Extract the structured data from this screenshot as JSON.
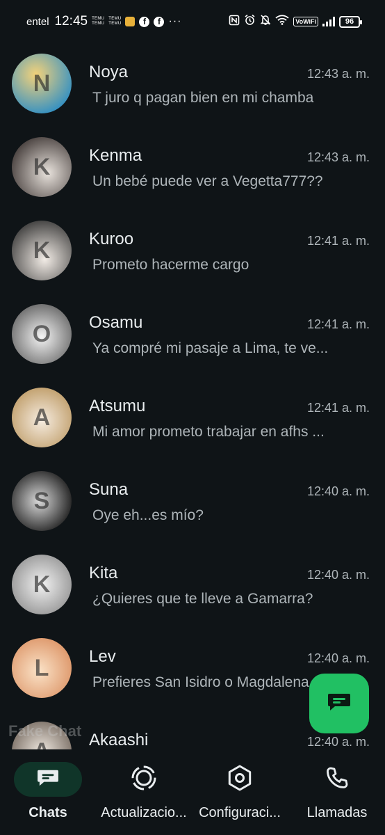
{
  "status_bar": {
    "carrier": "entel",
    "time": "12:45",
    "temu_line1": "TEMU",
    "temu_line2": "TEMU",
    "more": "···",
    "vowifi": "VoWiFi",
    "battery": "96",
    "icons": [
      "temu-icon",
      "temu-icon",
      "notification-icon",
      "facebook-icon",
      "facebook-icon",
      "more-icon",
      "nfc-icon",
      "alarm-icon",
      "silent-icon",
      "wifi-icon",
      "vowifi-icon",
      "signal-icon",
      "battery-icon"
    ]
  },
  "chats": [
    {
      "name": "Noya",
      "time": "12:43 a. m.",
      "message": "T juro q pagan bien en mi chamba",
      "avatar_initial": "N",
      "avatar_color": "#e0b05a"
    },
    {
      "name": "Kenma",
      "time": "12:43 a. m.",
      "message": "Un bebé puede ver a Vegetta777??",
      "avatar_initial": "K",
      "avatar_color": "#cfc8c2"
    },
    {
      "name": "Kuroo",
      "time": "12:41 a. m.",
      "message": "Prometo hacerme cargo",
      "avatar_initial": "K",
      "avatar_color": "#e8e4df"
    },
    {
      "name": "Osamu",
      "time": "12:41 a. m.",
      "message": "Ya compré mi pasaje a Lima, te ve...",
      "avatar_initial": "O",
      "avatar_color": "#dedede"
    },
    {
      "name": "Atsumu",
      "time": "12:41 a. m.",
      "message": "Mi amor prometo trabajar en afhs ...",
      "avatar_initial": "A",
      "avatar_color": "#e9d9c6"
    },
    {
      "name": "Suna",
      "time": "12:40 a. m.",
      "message": "Oye eh...es mío?",
      "avatar_initial": "S",
      "avatar_color": "#6e6e6e"
    },
    {
      "name": "Kita",
      "time": "12:40 a. m.",
      "message": "¿Quieres que te lleve a Gamarra?",
      "avatar_initial": "K",
      "avatar_color": "#d9d9d9"
    },
    {
      "name": "Lev",
      "time": "12:40 a. m.",
      "message": "Prefieres San Isidro o Magdalena",
      "avatar_initial": "L",
      "avatar_color": "#f0c8a0"
    },
    {
      "name": "Akaashi",
      "time": "12:40 a. m.",
      "message": "",
      "avatar_initial": "A",
      "avatar_color": "#d6cfc6"
    }
  ],
  "watermark": "Fake Chat",
  "fab": {
    "icon": "new-chat-icon",
    "color": "#21c063"
  },
  "nav": {
    "chats": "Chats",
    "updates": "Actualizacio...",
    "settings": "Configuraci...",
    "calls": "Llamadas"
  },
  "colors": {
    "background": "#0f1417",
    "accent": "#21c063",
    "active_pill": "#103529",
    "secondary_text": "#aeb5b9"
  }
}
